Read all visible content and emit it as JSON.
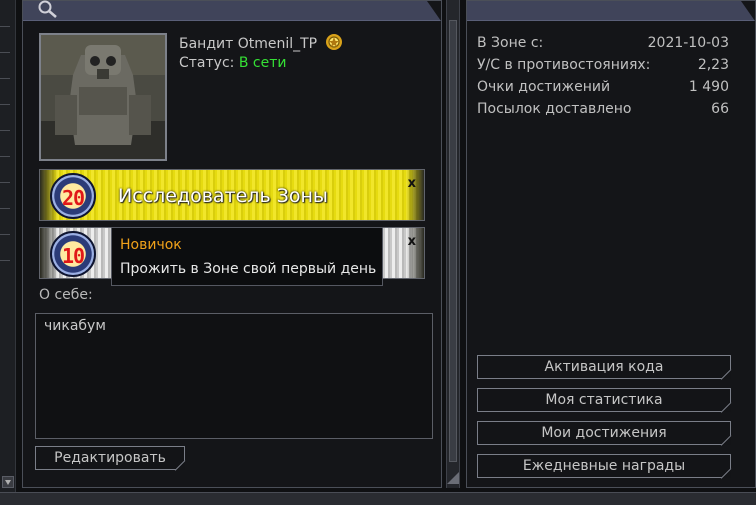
{
  "profile": {
    "name": "Бандит Otmenil_TP",
    "status_label": "Статус:",
    "status_value": "В сети"
  },
  "achievements": [
    {
      "level": "20",
      "title": "Исследователь Зоны",
      "close": "x"
    },
    {
      "level": "10",
      "title": "",
      "close": "x"
    }
  ],
  "tooltip": {
    "title": "Новичок",
    "description": "Прожить в Зоне свой первый день"
  },
  "about": {
    "label": "О себе:",
    "text": "чикабум"
  },
  "edit_button": "Редактировать",
  "stats": [
    {
      "label": "В Зоне с:",
      "value": "2021-10-03"
    },
    {
      "label": "У/С в противостояниях:",
      "value": "2,23"
    },
    {
      "label": "Очки достижений",
      "value": "1 490"
    },
    {
      "label": "Посылок доставлено",
      "value": "66"
    }
  ],
  "right_buttons": [
    "Активация кода",
    "Моя статистика",
    "Мои достижения",
    "Ежедневные награды"
  ],
  "icons": [
    "search-icon",
    "rank-icon",
    "scroll-down-icon"
  ],
  "colors": {
    "online": "#35e035",
    "tooltip_title": "#f0a11a",
    "header": "#40445a"
  }
}
